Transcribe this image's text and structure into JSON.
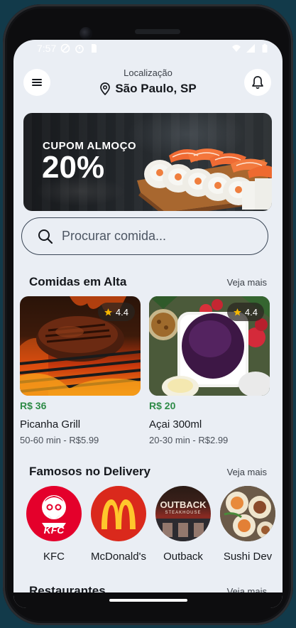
{
  "status_bar": {
    "time": "7:57"
  },
  "header": {
    "location_label": "Localização",
    "city": "São Paulo, SP"
  },
  "banner": {
    "title": "CUPOM ALMOÇO",
    "value": "20%"
  },
  "search": {
    "placeholder": "Procurar comida..."
  },
  "trending": {
    "title": "Comidas em Alta",
    "see_more": "Veja mais",
    "items": [
      {
        "rating": "4.4",
        "price": "R$ 36",
        "name": "Picanha Grill",
        "meta": "50-60 min - R$5.99"
      },
      {
        "rating": "4.4",
        "price": "R$ 20",
        "name": "Açai 300ml",
        "meta": "20-30 min - R$2.99"
      }
    ]
  },
  "delivery": {
    "title": "Famosos no Delivery",
    "see_more": "Veja mais",
    "brands": [
      {
        "name": "KFC",
        "logo_text": "KFC"
      },
      {
        "name": "McDonald's"
      },
      {
        "name": "Outback",
        "logo_text": "OUTBACK",
        "logo_sub": "STEAKHOUSE"
      },
      {
        "name": "Sushi Dev"
      }
    ]
  },
  "restaurants": {
    "title": "Restaurantes",
    "see_more": "Veja mais"
  },
  "colors": {
    "price_green": "#2e8b47",
    "background": "#eaeef4",
    "kfc_red": "#e4002b",
    "mcd_red": "#da291c",
    "mcd_yellow": "#ffc72c"
  },
  "icons": [
    "menu-icon",
    "bell-icon",
    "location-pin-icon",
    "search-icon",
    "star-icon",
    "wifi-icon",
    "signal-icon",
    "battery-icon"
  ]
}
